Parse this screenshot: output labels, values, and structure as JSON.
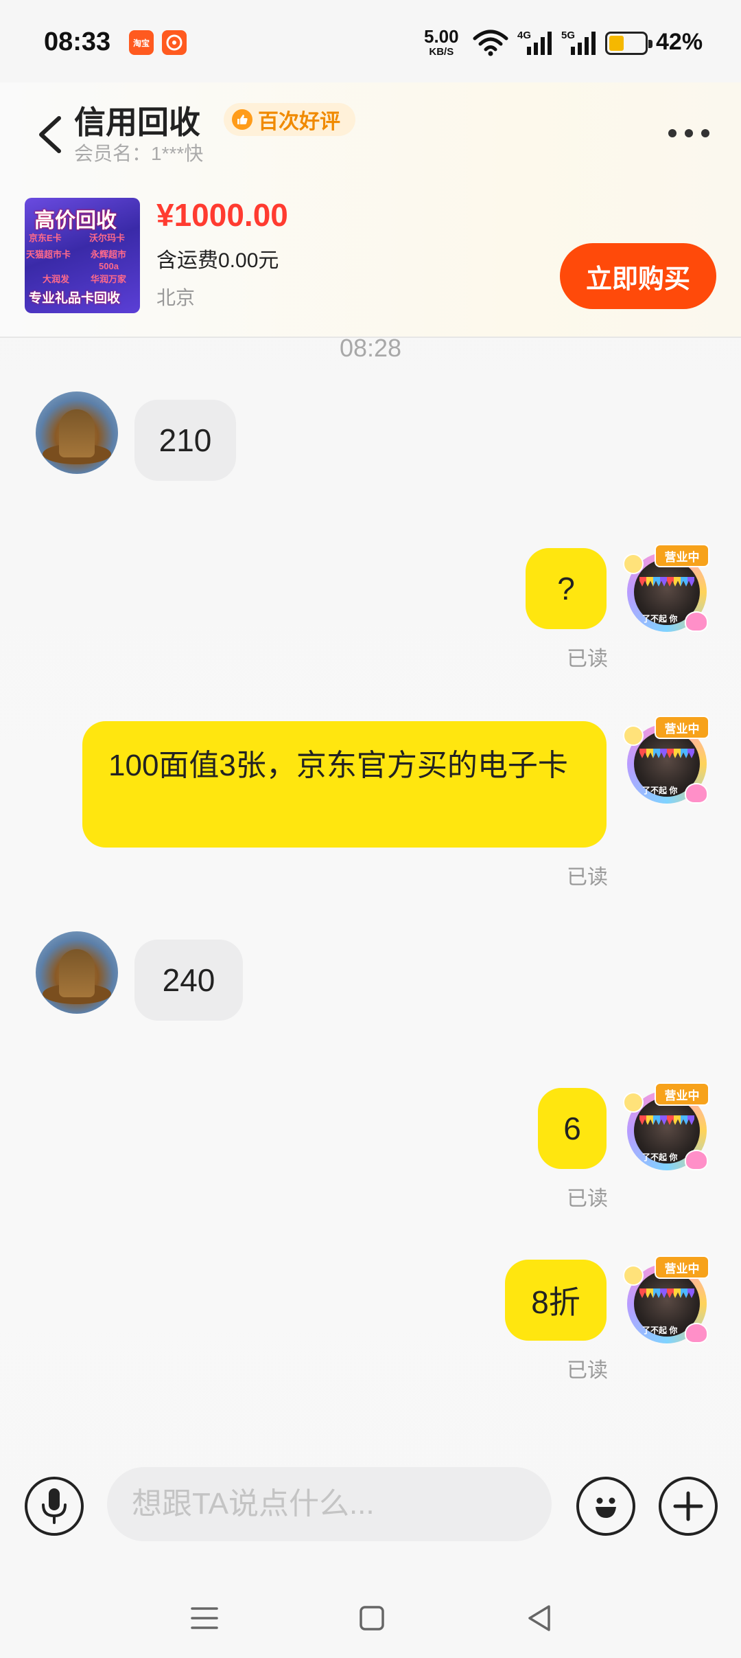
{
  "status_bar": {
    "time": "08:33",
    "app_icons": [
      "淘宝",
      "淘宝红包"
    ],
    "net_speed_value": "5.00",
    "net_speed_unit": "KB/S",
    "signal_1_label": "4G",
    "signal_2_label": "5G",
    "battery_percent": "42%",
    "battery_level": 0.42
  },
  "header": {
    "title": "信用回收",
    "badge": "百次好评",
    "member": "会员名：1***快"
  },
  "product": {
    "thumb_line1": "高价回收",
    "thumb_tags": [
      "京东E卡",
      "沃尔玛卡",
      "天猫超市卡",
      "永辉超市",
      "大润发",
      "华润万家",
      "500a"
    ],
    "thumb_line3": "专业礼品卡回收",
    "price": "¥1000.00",
    "shipping": "含运费0.00元",
    "location": "北京",
    "buy_label": "立即购买"
  },
  "chat": {
    "timestamp": "08:28",
    "avatar_tag": "营业中",
    "avatar_caption": "了不起 你",
    "messages": [
      {
        "side": "left",
        "text": "210"
      },
      {
        "side": "right",
        "text": "?",
        "status": "已读"
      },
      {
        "side": "right",
        "text": "100面值3张，京东官方买的电子卡",
        "status": "已读"
      },
      {
        "side": "left",
        "text": "240"
      },
      {
        "side": "right",
        "text": "6",
        "status": "已读"
      },
      {
        "side": "right",
        "text": "8折",
        "status": "已读"
      }
    ]
  },
  "input": {
    "placeholder": "想跟TA说点什么..."
  },
  "colors": {
    "accent_orange": "#ff4a0a",
    "price_red": "#ff3b30",
    "bubble_yellow": "#ffe60f",
    "bubble_gray": "#ececed"
  }
}
